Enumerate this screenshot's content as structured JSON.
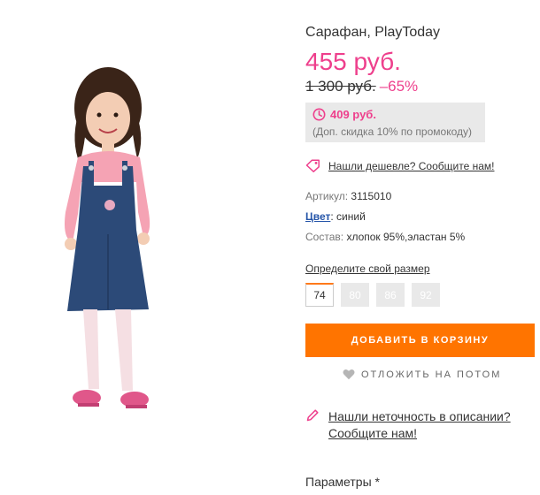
{
  "product": {
    "title": "Сарафан, PlayToday",
    "price": "455 руб.",
    "old_price": "1 300 руб.",
    "discount": "–65%"
  },
  "promo": {
    "price": "409 руб.",
    "note": "(Доп. скидка 10% по промокоду)",
    "icon": "clock-icon",
    "accent_color": "#ee3f8c",
    "bg_color": "#e9e9e9"
  },
  "cheaper": {
    "label": "Нашли дешевле? Сообщите нам!",
    "icon": "tag-icon"
  },
  "details": {
    "article_label": "Артикул:",
    "article_value": "3115010",
    "color_label": "Цвет",
    "color_value": ": синий",
    "composition_label": "Состав:",
    "composition_value": "хлопок 95%,эластан 5%"
  },
  "size": {
    "title": "Определите свой размер",
    "options": [
      "74",
      "80",
      "86",
      "92"
    ],
    "selected": "74"
  },
  "actions": {
    "add_to_cart": "ДОБАВИТЬ В КОРЗИНУ",
    "save_later": "ОТЛОЖИТЬ НА ПОТОМ",
    "button_color": "#ff7400"
  },
  "typo": {
    "line1": "Нашли неточность в описании?",
    "line2": "Сообщите нам!",
    "icon": "pencil-icon"
  },
  "params": {
    "label": "Параметры *"
  }
}
